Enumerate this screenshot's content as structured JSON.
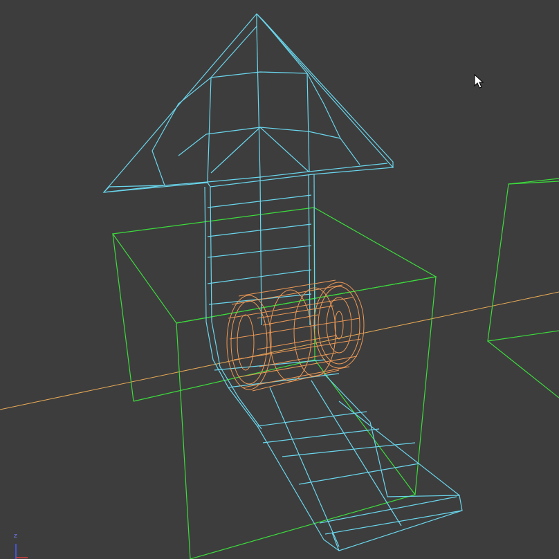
{
  "viewport": {
    "background": "#3d3d3d",
    "axis_indicator_label": "z"
  },
  "colors": {
    "arrow_wireframe": "#6ad7ee",
    "cube_wireframe": "#3cdc3c",
    "cylinder_wireframe": "#ef9955",
    "horizon_line": "#e8aa55",
    "gizmo_z_axis": "#4a5cff",
    "gizmo_x_axis": "#d84040"
  },
  "objects": [
    {
      "name": "arrow-mesh",
      "kind": "wireframe"
    },
    {
      "name": "box-mesh",
      "kind": "wireframe"
    },
    {
      "name": "cylinder-mesh",
      "kind": "wireframe",
      "selected": true
    },
    {
      "name": "box-mesh-2",
      "kind": "wireframe"
    }
  ],
  "cursor": {
    "icon": "arrow-cursor-icon"
  }
}
